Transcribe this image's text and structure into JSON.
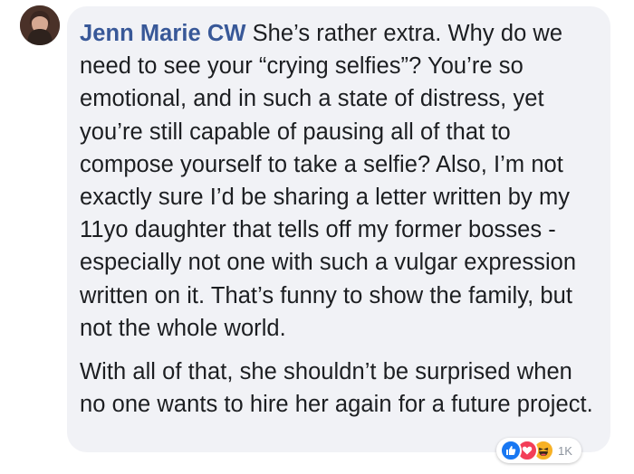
{
  "comment": {
    "author": "Jenn Marie CW",
    "paragraph1": "She’s rather extra. Why do we need to see your “crying selfies”? You’re so emotional, and in such a state of distress, yet you’re still capable of pausing all of that to compose yourself to take a selfie? Also, I’m not exactly sure I’d be sharing a letter written by my 11yo daughter that tells off my former bosses - especially not one with such a vulgar expression written on it. That’s funny to show the family, but not the whole world.",
    "paragraph2": "With all of that, she shouldn’t be surprised when no one wants to hire her again for a future project."
  },
  "reactions": {
    "icons": [
      "like-icon",
      "love-icon",
      "haha-icon"
    ],
    "count": "1K"
  },
  "colors": {
    "author": "#385898",
    "bubble": "#f1f2f6",
    "like": "#1877f2",
    "love": "#f33e58",
    "haha": "#f7b125"
  }
}
